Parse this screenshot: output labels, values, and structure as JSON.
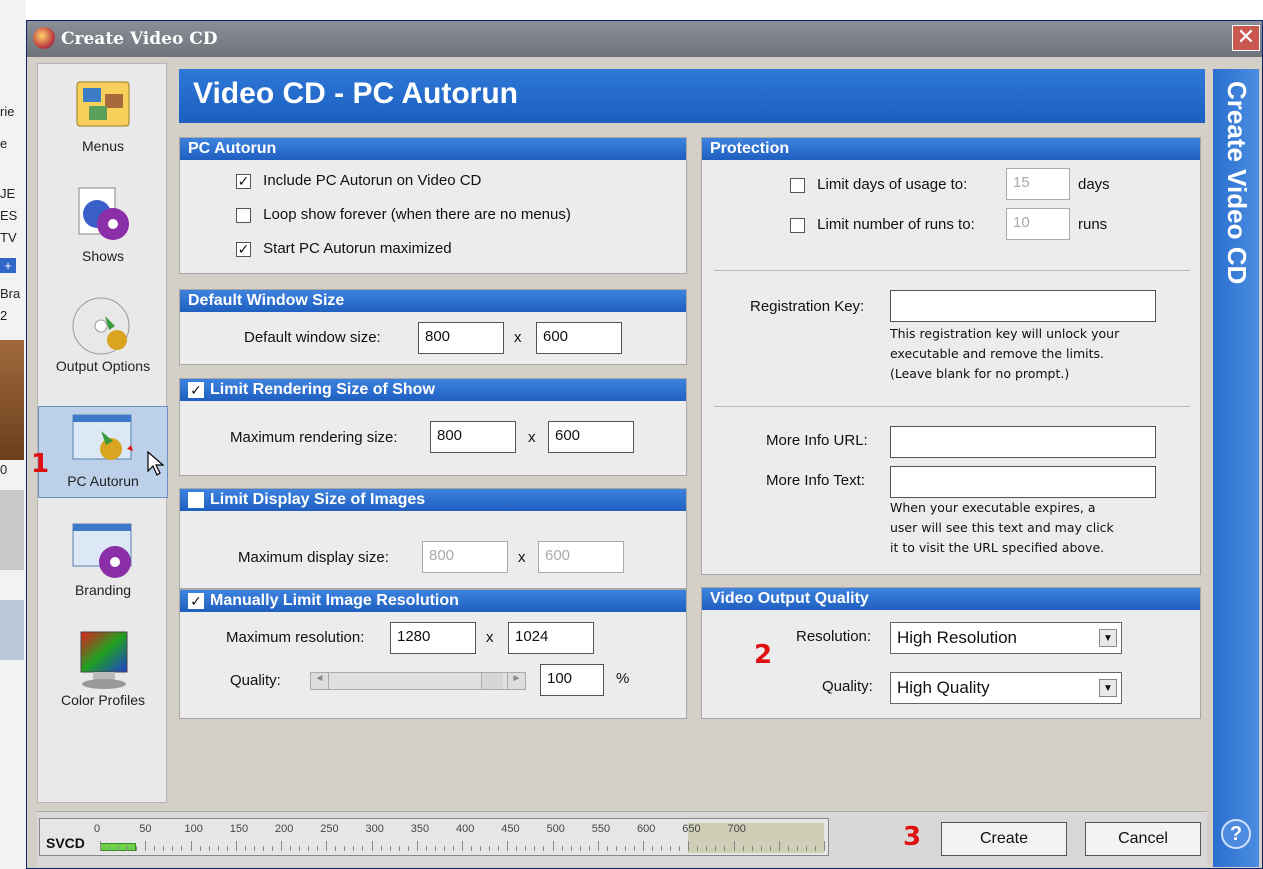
{
  "window": {
    "title": "Create Video CD",
    "close_glyph": "✕"
  },
  "background_fragments": [
    "rie",
    "e",
    "JE",
    "ES",
    "TV",
    "+",
    "Bra",
    "2",
    "0"
  ],
  "sidebar": {
    "items": [
      {
        "label": "Menus",
        "icon": "menus-icon"
      },
      {
        "label": "Shows",
        "icon": "shows-icon"
      },
      {
        "label": "Output Options",
        "icon": "output-options-icon"
      },
      {
        "label": "PC Autorun",
        "icon": "pc-autorun-icon",
        "selected": true
      },
      {
        "label": "Branding",
        "icon": "branding-icon"
      },
      {
        "label": "Color Profiles",
        "icon": "color-profiles-icon"
      }
    ]
  },
  "annotations": {
    "one": "1",
    "two": "2",
    "three": "3"
  },
  "header": {
    "title": "Video CD - PC Autorun",
    "side_title": "Create Video CD",
    "help": "?"
  },
  "pc_autorun": {
    "title": "PC Autorun",
    "include_label": "Include PC Autorun on Video CD",
    "loop_label": "Loop show forever (when there are no menus)",
    "maximized_label": "Start PC Autorun maximized"
  },
  "default_window": {
    "title": "Default Window Size",
    "label": "Default window size:",
    "width": "800",
    "x": "x",
    "height": "600"
  },
  "limit_render": {
    "title": "Limit Rendering Size of Show",
    "label": "Maximum rendering size:",
    "width": "800",
    "x": "x",
    "height": "600"
  },
  "limit_display": {
    "title": "Limit Display Size of Images",
    "label": "Maximum display size:",
    "width": "800",
    "x": "x",
    "height": "600"
  },
  "limit_resolution": {
    "title": "Manually Limit Image Resolution",
    "res_label": "Maximum resolution:",
    "width": "1280",
    "x": "x",
    "height": "1024",
    "quality_label": "Quality:",
    "quality": "100",
    "percent": "%"
  },
  "protection": {
    "title": "Protection",
    "days_label": "Limit days of usage to:",
    "days_value": "15",
    "days_unit": "days",
    "runs_label": "Limit number of runs to:",
    "runs_value": "10",
    "runs_unit": "runs",
    "key_label": "Registration Key:",
    "key_help": [
      "This registration key will unlock your",
      "executable and remove the limits.",
      "(Leave blank for no prompt.)"
    ],
    "url_label": "More Info URL:",
    "text_label": "More Info Text:",
    "text_help": [
      "When your executable expires, a",
      "user will see this text and may click",
      "it to visit the URL specified above."
    ]
  },
  "video_quality": {
    "title": "Video Output Quality",
    "res_label": "Resolution:",
    "res_value": "High Resolution",
    "quality_label": "Quality:",
    "quality_value": "High Quality"
  },
  "meter": {
    "label": "SVCD",
    "ticks": [
      "0",
      "50",
      "100",
      "150",
      "200",
      "250",
      "300",
      "350",
      "400",
      "450",
      "500",
      "550",
      "600",
      "650",
      "700"
    ],
    "fill_value": 40,
    "max": 800
  },
  "buttons": {
    "create": "Create",
    "cancel": "Cancel"
  }
}
